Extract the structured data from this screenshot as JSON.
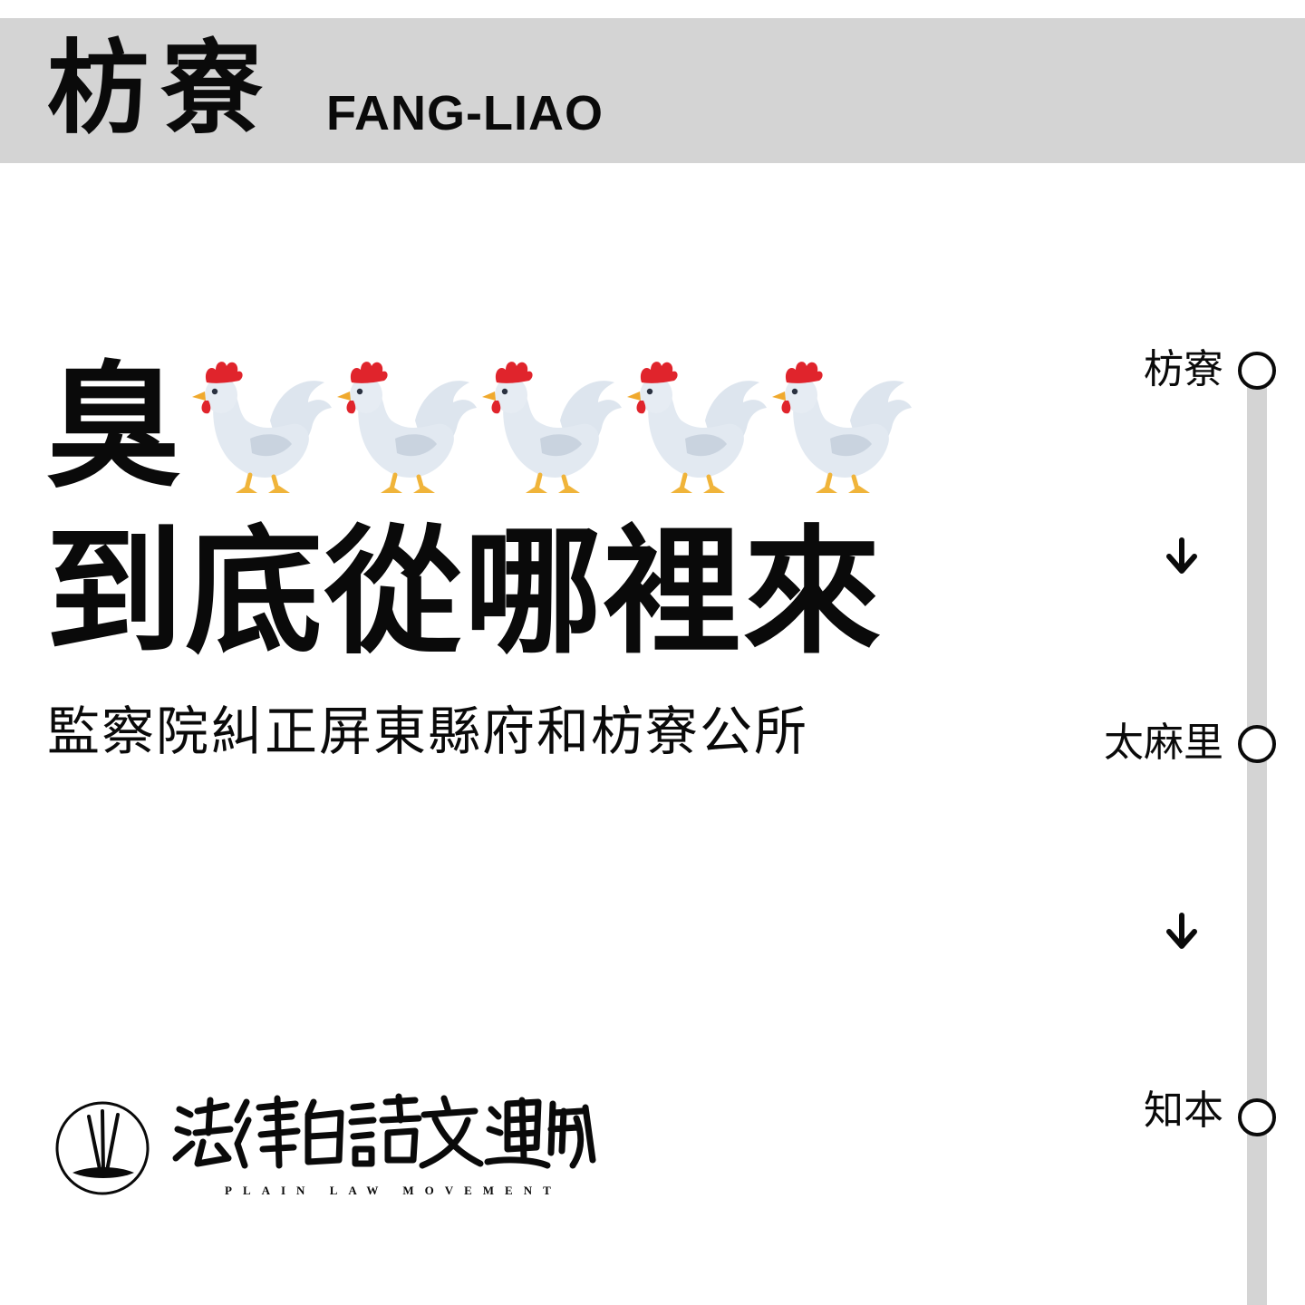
{
  "header": {
    "station_zh": "枋寮",
    "station_en": "FANG-LIAO"
  },
  "headline": {
    "line1": "臭",
    "chicken_icons": [
      "chicken-icon",
      "chicken-icon",
      "chicken-icon",
      "chicken-icon",
      "chicken-icon"
    ],
    "line2": "到底從哪裡來",
    "subline": "監察院糾正屏東縣府和枋寮公所"
  },
  "route": {
    "stops": [
      {
        "name": "枋寮"
      },
      {
        "name": "太麻里"
      },
      {
        "name": "知本"
      }
    ],
    "arrow_icon": "arrow-down-icon",
    "line_color": "#d4d4d4"
  },
  "logo": {
    "emblem_icon": "emblem-icon",
    "text": "法律白話文運動",
    "subtitle": "PLAIN LAW MOVEMENT"
  }
}
